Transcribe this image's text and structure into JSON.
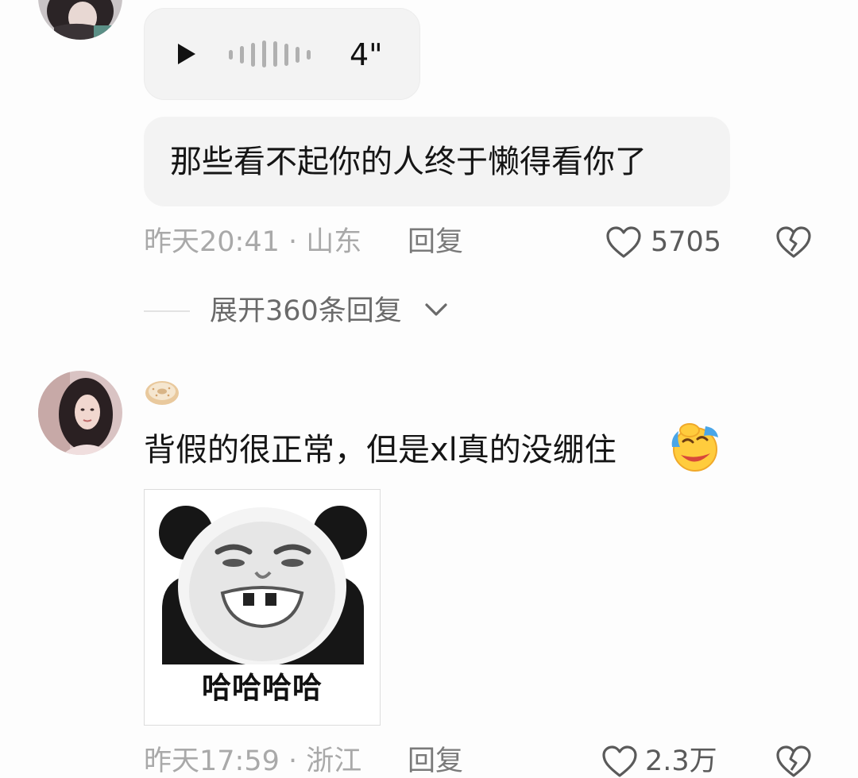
{
  "comment1": {
    "voice": {
      "duration": "4\""
    },
    "text": "那些看不起你的人终于懒得看你了",
    "time_location": "昨天20:41 · 山东",
    "reply_label": "回复",
    "like_count": "5705",
    "icons": {
      "play": "play-icon",
      "waveform": "waveform-icon",
      "like": "heart-icon",
      "dislike": "broken-heart-icon"
    }
  },
  "expand_replies": {
    "label": "展开360条回复",
    "icon": "chevron-down-icon"
  },
  "comment2": {
    "badge_icon": "donut-badge-icon",
    "text": "背假的很正常，但是xl真的没绷住",
    "emoji": "rolling-laughing-emoji-icon",
    "sticker_caption": "哈哈哈哈",
    "time_location": "昨天17:59 · 浙江",
    "reply_label": "回复",
    "like_count": "2.3万"
  },
  "colors": {
    "background": "#fdfdfd",
    "bubble": "#f3f3f3",
    "meta_text": "#a9a9a9",
    "reply_text": "#7a7a7a",
    "body_text": "#151515"
  }
}
